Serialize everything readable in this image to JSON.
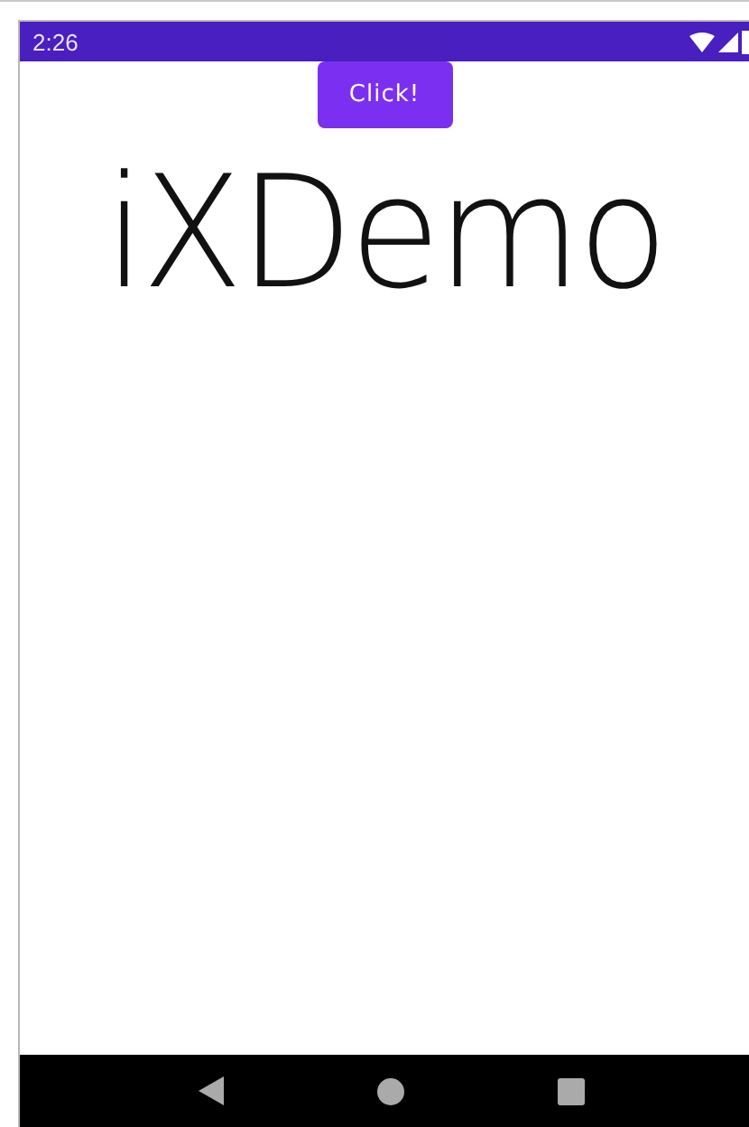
{
  "status_bar": {
    "time": "2:26"
  },
  "button": {
    "label": "Click!"
  },
  "title": "iXDemo"
}
